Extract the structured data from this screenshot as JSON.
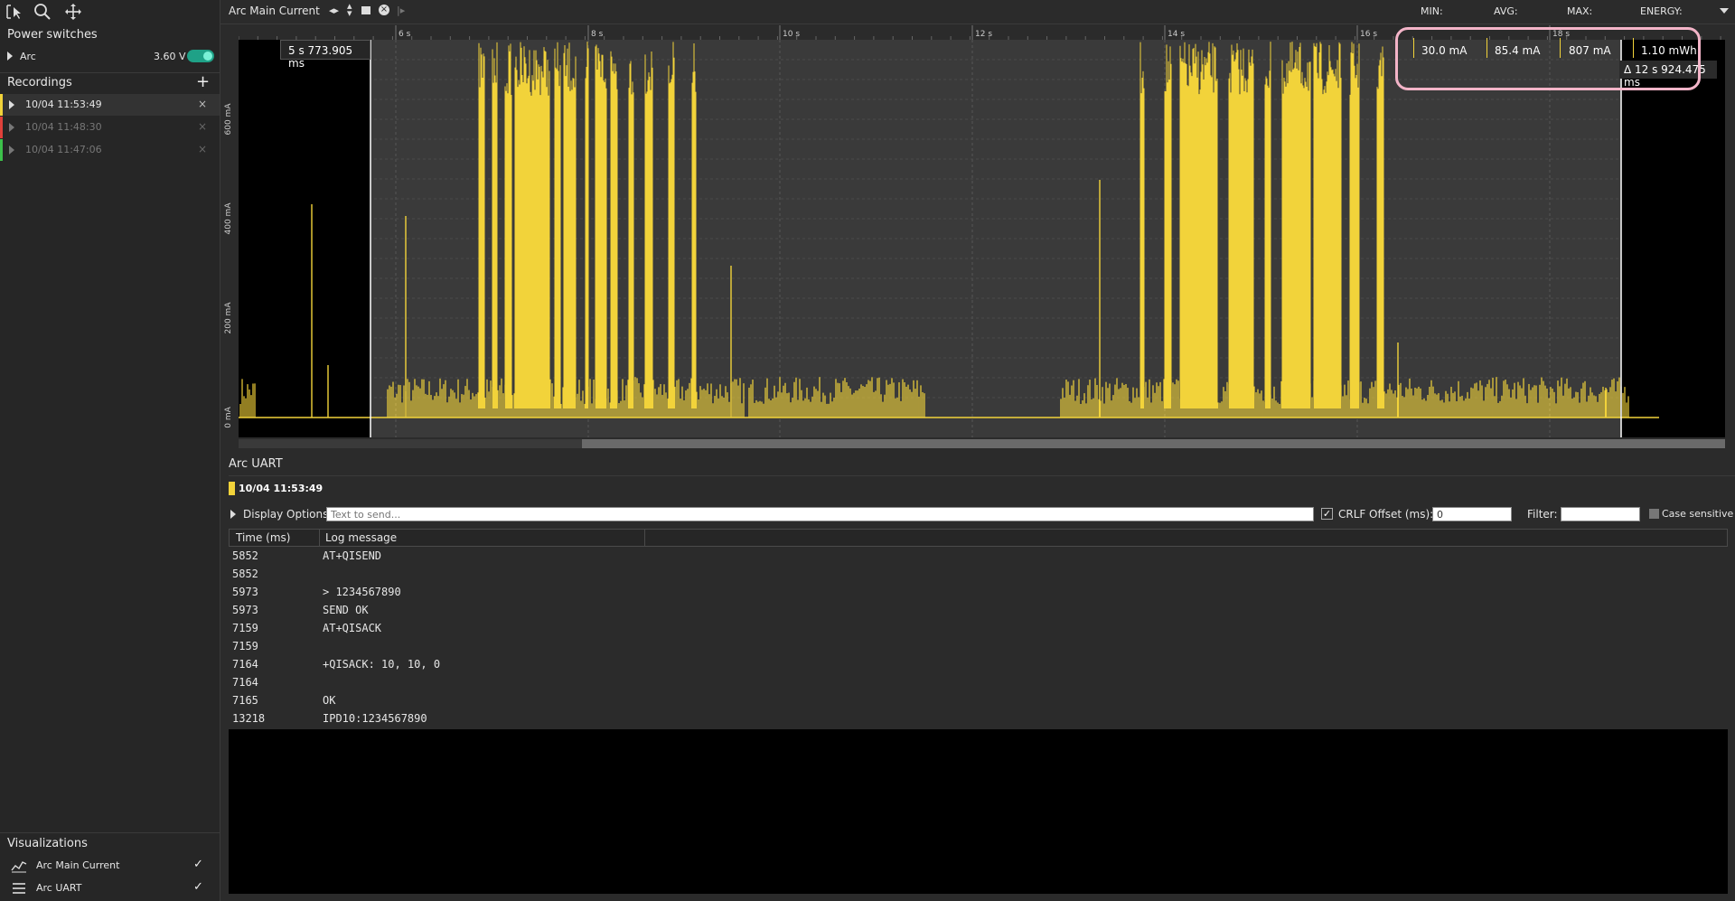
{
  "sidebar": {
    "power_switches_title": "Power switches",
    "arc_label": "Arc",
    "arc_voltage": "3.60 V",
    "recordings_title": "Recordings",
    "add_symbol": "+",
    "recordings": [
      {
        "label": "10/04 11:53:49",
        "color": "#f2d33a",
        "active": true
      },
      {
        "label": "10/04 11:48:30",
        "color": "#e0413a",
        "active": false
      },
      {
        "label": "10/04 11:47:06",
        "color": "#3cc04a",
        "active": false
      }
    ],
    "remove_symbol": "×",
    "visualizations_title": "Visualizations",
    "visualizations": [
      {
        "label": "Arc Main Current",
        "icon": "line-chart-icon",
        "checked": "✓"
      },
      {
        "label": "Arc UART",
        "icon": "list-icon",
        "checked": "✓"
      }
    ]
  },
  "header": {
    "title": "Arc Main Current",
    "min_label": "MIN:",
    "avg_label": "AVG:",
    "max_label": "MAX:",
    "energy_label": "ENERGY:"
  },
  "plot": {
    "cursor_time": "5 s 773.905 ms",
    "stats": {
      "min": "30.0 mA",
      "avg": "85.4 mA",
      "max": "807 mA",
      "energy": "1.10 mWh"
    },
    "delta": "Δ 12 s 924.475 ms",
    "time_ticks": [
      "6 s",
      "8 s",
      "10 s",
      "12 s",
      "14 s",
      "16 s",
      "18 s"
    ],
    "y_ticks": [
      "0 mA",
      "200 mA",
      "400 mA",
      "600 mA"
    ],
    "trace_color": "#f2d33a"
  },
  "uart": {
    "title": "Arc UART",
    "recording_label": "10/04 11:53:49",
    "display_options": "Display Options",
    "send_placeholder": "Text to send...",
    "crlf_label": "CRLF",
    "crlf_checked": "✓",
    "offset_label": "Offset (ms):",
    "offset_value": "0",
    "filter_label": "Filter:",
    "filter_value": "",
    "case_label": "Case sensitive",
    "columns": [
      "Time (ms)",
      "Log message"
    ],
    "rows": [
      {
        "time": "5852",
        "msg": "AT+QISEND"
      },
      {
        "time": "5852",
        "msg": ""
      },
      {
        "time": "5973",
        "msg": "> 1234567890"
      },
      {
        "time": "5973",
        "msg": "SEND OK"
      },
      {
        "time": "7159",
        "msg": "AT+QISACK"
      },
      {
        "time": "7159",
        "msg": ""
      },
      {
        "time": "7164",
        "msg": "+QISACK: 10, 10, 0"
      },
      {
        "time": "7164",
        "msg": ""
      },
      {
        "time": "7165",
        "msg": "OK"
      },
      {
        "time": "13218",
        "msg": "IPD10:1234567890"
      }
    ]
  }
}
